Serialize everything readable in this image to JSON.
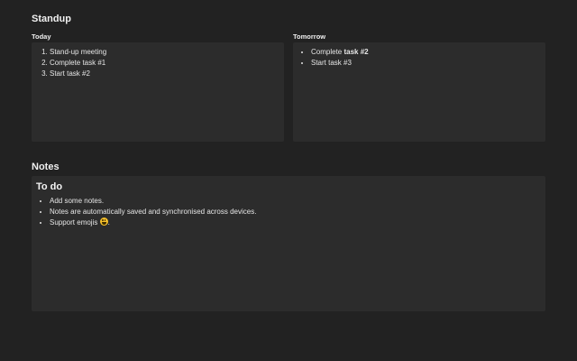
{
  "standup": {
    "title": "Standup",
    "today": {
      "label": "Today",
      "items": [
        "Stand-up meeting",
        "Complete task #1",
        "Start task #2"
      ]
    },
    "tomorrow": {
      "label": "Tomorrow",
      "items": [
        {
          "prefix": "Complete ",
          "bold": "task #2"
        },
        {
          "text": "Start task #3"
        }
      ]
    }
  },
  "notes": {
    "title": "Notes",
    "heading": "To do",
    "items": [
      "Add some notes.",
      "Notes are automatically saved and synchronised across devices.",
      "Support emojis"
    ],
    "emoji_suffix": ".",
    "emoji_icon": "grinning-face-emoji"
  },
  "colors": {
    "background": "#222222",
    "panel": "#2c2c2c",
    "text": "#e6e6e6"
  }
}
